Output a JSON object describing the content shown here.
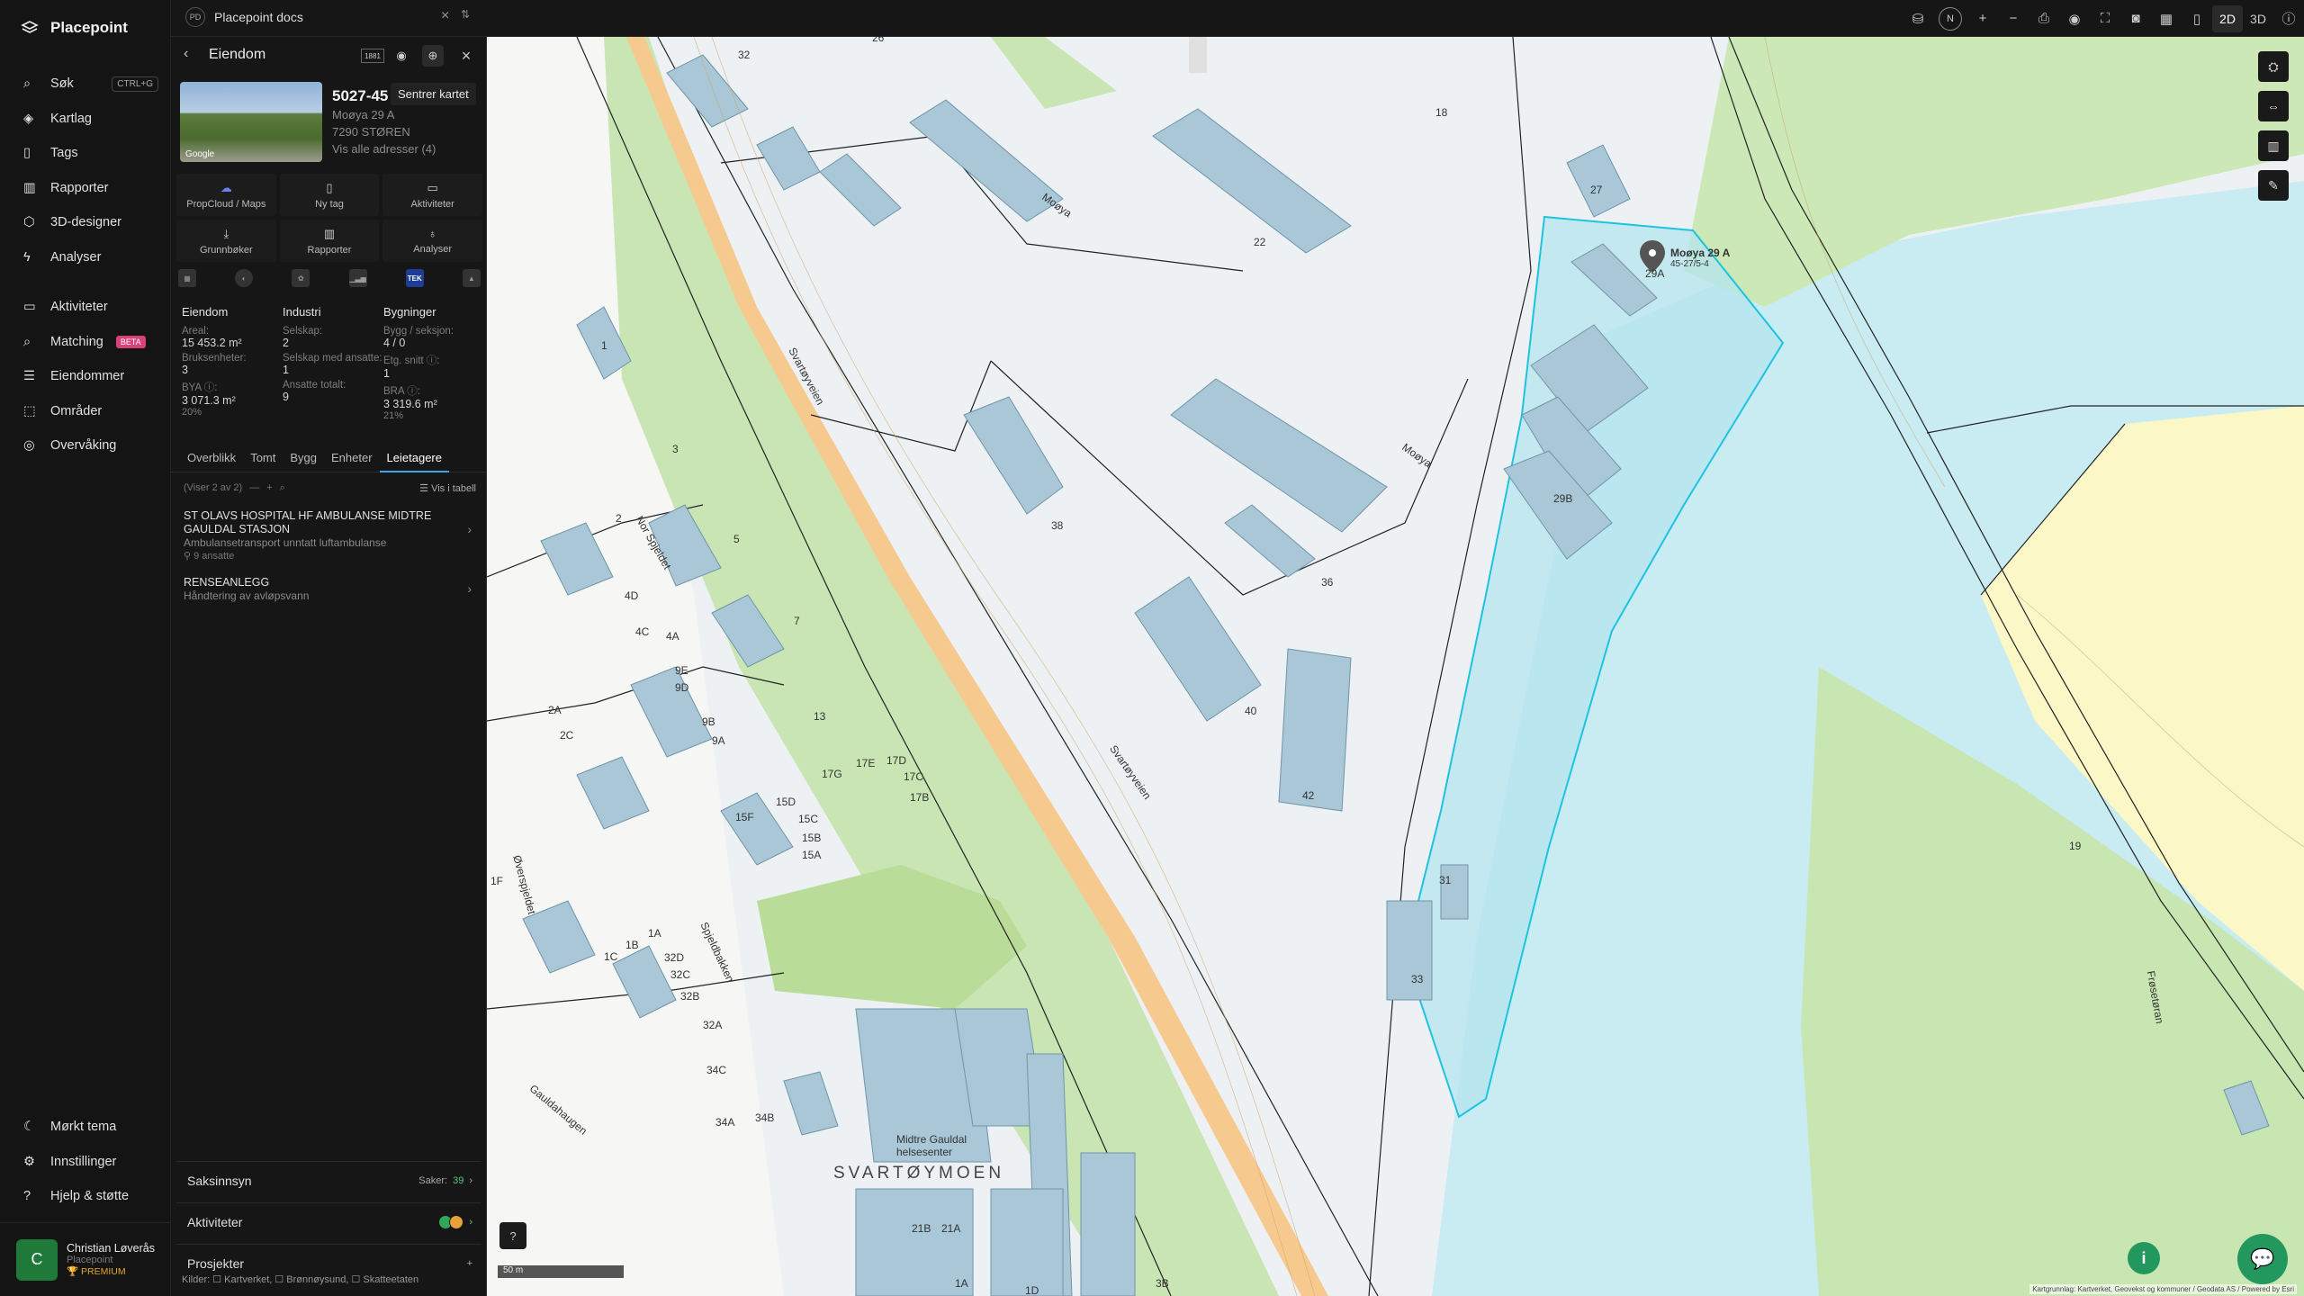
{
  "app": {
    "name": "Placepoint"
  },
  "nav": {
    "items": [
      {
        "label": "Søk",
        "icon": "search-icon",
        "kbd": "CTRL+G"
      },
      {
        "label": "Kartlag",
        "icon": "layers-icon"
      },
      {
        "label": "Tags",
        "icon": "bookmark-icon"
      },
      {
        "label": "Rapporter",
        "icon": "chart-icon"
      },
      {
        "label": "3D-designer",
        "icon": "cube-icon"
      },
      {
        "label": "Analyser",
        "icon": "lightning-icon"
      }
    ],
    "items2": [
      {
        "label": "Aktiviteter",
        "icon": "chat-icon"
      },
      {
        "label": "Matching",
        "icon": "match-icon",
        "badge": "BETA"
      },
      {
        "label": "Eiendommer",
        "icon": "list-icon"
      },
      {
        "label": "Områder",
        "icon": "area-icon"
      },
      {
        "label": "Overvåking",
        "icon": "target-icon"
      }
    ],
    "bottom": [
      {
        "label": "Mørkt tema",
        "icon": "moon-icon"
      },
      {
        "label": "Innstillinger",
        "icon": "gear-icon"
      },
      {
        "label": "Hjelp & støtte",
        "icon": "help-icon"
      }
    ]
  },
  "user": {
    "initial": "C",
    "name": "Christian Løverås",
    "org": "Placepoint",
    "plan": "PREMIUM"
  },
  "topbar": {
    "doc_badge": "PD",
    "doc_title": "Placepoint docs",
    "mode_2d": "2D",
    "mode_3d": "3D",
    "compass": "N"
  },
  "panel": {
    "title": "Eiendom",
    "badge_1881": "1881",
    "tooltip": "Sentrer kartet",
    "thumb_label": "Google",
    "prop_id": "5027-45",
    "address": "Moøya 29 A",
    "postal": "7290 STØREN",
    "all_addresses": "Vis alle adresser (4)",
    "actions": [
      {
        "label": "PropCloud / Maps",
        "icon": "cloud-icon"
      },
      {
        "label": "Ny tag",
        "icon": "bookmark-icon"
      },
      {
        "label": "Aktiviteter",
        "icon": "chat-icon"
      },
      {
        "label": "Grunnbøker",
        "icon": "download-icon"
      },
      {
        "label": "Rapporter",
        "icon": "chart-icon"
      },
      {
        "label": "Analyser",
        "icon": "bulb-icon"
      }
    ],
    "mini_tek": "TEK",
    "stats": {
      "eiendom": {
        "heading": "Eiendom",
        "areal_label": "Areal:",
        "areal": "15 453.2 m²",
        "bruks_label": "Bruksenheter:",
        "bruks": "3",
        "bya_label": "BYA ⓘ:",
        "bya": "3 071.3 m²",
        "bya_pct": "20%"
      },
      "industri": {
        "heading": "Industri",
        "selskap_label": "Selskap:",
        "selskap": "2",
        "ansatte_label": "Selskap med ansatte:",
        "ansatte": "1",
        "total_label": "Ansatte totalt:",
        "total": "9"
      },
      "bygninger": {
        "heading": "Bygninger",
        "bygg_label": "Bygg / seksjon:",
        "bygg": "4 / 0",
        "etg_label": "Etg. snitt ⓘ:",
        "etg": "1",
        "bra_label": "BRA ⓘ:",
        "bra": "3 319.6 m²",
        "bra_pct": "21%"
      }
    },
    "tabs": [
      "Overblikk",
      "Tomt",
      "Bygg",
      "Enheter",
      "Leietagere"
    ],
    "list_count": "(Viser 2 av 2)",
    "list_view": "Vis i tabell",
    "entries": [
      {
        "title": "ST OLAVS HOSPITAL HF AMBULANSE MIDTRE GAULDAL STASJON",
        "sub": "Ambulansetransport unntatt luftambulanse",
        "meta": "9 ansatte"
      },
      {
        "title": "RENSEANLEGG",
        "sub": "Håndtering av avløpsvann",
        "meta": ""
      }
    ],
    "sections": {
      "saksinnsyn": "Saksinnsyn",
      "saker_label": "Saker:",
      "saker": "39",
      "aktiviteter": "Aktiviteter",
      "prosjekter": "Prosjekter"
    },
    "sources": "Kilder: ☐ Kartverket, ☐ Brønnøysund, ☐ Skatteetaten"
  },
  "map": {
    "labels": [
      "Moøya",
      "Moøya",
      "Svartøyveien",
      "Svartøyveien",
      "Nor Spjeldet",
      "Øverspjeldet",
      "Spjeldbakken",
      "Gauldahaugen",
      "Frøsetøran",
      "SVARTØYMOEN",
      "Midtre Gauldal helsesenter",
      "Moøya 29 A",
      "45-27/5-4"
    ],
    "numbers": [
      "32",
      "26",
      "18",
      "22",
      "27",
      "29A",
      "29B",
      "38",
      "36",
      "40",
      "42",
      "31",
      "33",
      "1",
      "3",
      "2",
      "5",
      "7",
      "4D",
      "4C",
      "4A",
      "9E",
      "9D",
      "9B",
      "9A",
      "13",
      "2A",
      "2C",
      "17G",
      "17E",
      "17D",
      "17C",
      "17B",
      "15D",
      "15C",
      "15B",
      "15A",
      "15F",
      "1F",
      "1B",
      "1A",
      "1C",
      "32D",
      "32C",
      "32B",
      "32A",
      "34C",
      "34A",
      "34B",
      "21B",
      "21A",
      "1A",
      "1D",
      "3B",
      "19"
    ],
    "scale": "50 m",
    "attribution": "Kartgrunnlag: Kartverket, Geovekst og kommuner / Geodata AS / Powered by Esri"
  }
}
